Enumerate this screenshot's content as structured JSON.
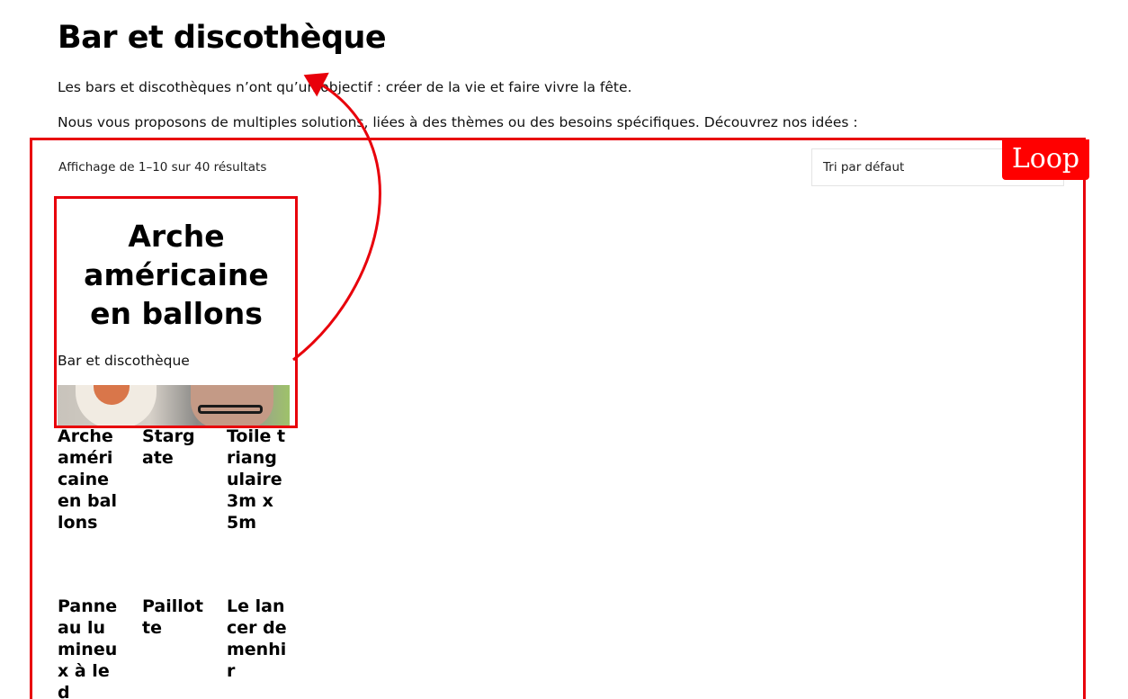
{
  "page": {
    "title": "Bar et discothèque",
    "intro_1": "Les bars et discothèques n’ont qu’un objectif : créer de la vie et faire vivre la fête.",
    "intro_2": "Nous vous proposons de multiples solutions, liées à des thèmes ou des besoins spécifiques. Découvrez nos idées :"
  },
  "loop": {
    "label": "Loop",
    "result_count": "Affichage de 1–10 sur 40 résultats",
    "sort_selected": "Tri par défaut"
  },
  "featured": {
    "title": "Arche américaine en ballons",
    "category": "Bar et discothèque"
  },
  "products": [
    {
      "title": "Arche américaine en ballons"
    },
    {
      "title": "Stargate"
    },
    {
      "title": "Toile triangulaire 3m x 5m"
    },
    {
      "title": "Panneau lumineux à led"
    },
    {
      "title": "Paillotte"
    },
    {
      "title": "Le lancer de menhir"
    }
  ],
  "colors": {
    "annotation": "#e8000b",
    "loop_tag_bg": "#ff0000",
    "text": "#000000"
  }
}
